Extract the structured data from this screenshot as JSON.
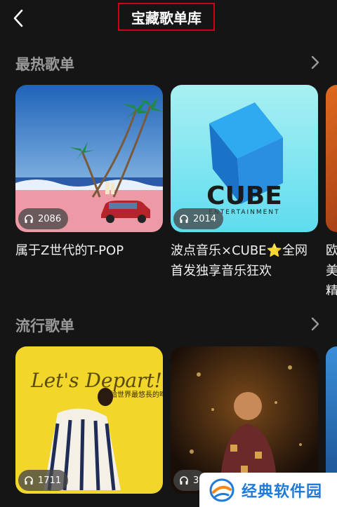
{
  "header": {
    "title": "宝藏歌单库"
  },
  "sections": [
    {
      "title": "最热歌单",
      "cards": [
        {
          "plays": "2086",
          "title": "属于Z世代的T-POP"
        },
        {
          "plays": "2014",
          "title": "波点音乐×CUBE⭐全网首发独享音乐狂欢",
          "cover_text": "CUBE",
          "cover_subtext": "ENTERTAINMENT"
        },
        {
          "title": "欧美精"
        }
      ]
    },
    {
      "title": "流行歌单",
      "cards": [
        {
          "plays": "1711",
          "cover_text": "Let's Depart!",
          "cover_subtext": "給世界最悠長的吻"
        },
        {
          "plays": "3"
        },
        {}
      ]
    }
  ],
  "watermark": {
    "text": "经典软件园"
  },
  "colors": {
    "background": "#151515",
    "accent": "#d0021b",
    "section_title": "#9a9a9a",
    "watermark": "#1f7ad8"
  }
}
